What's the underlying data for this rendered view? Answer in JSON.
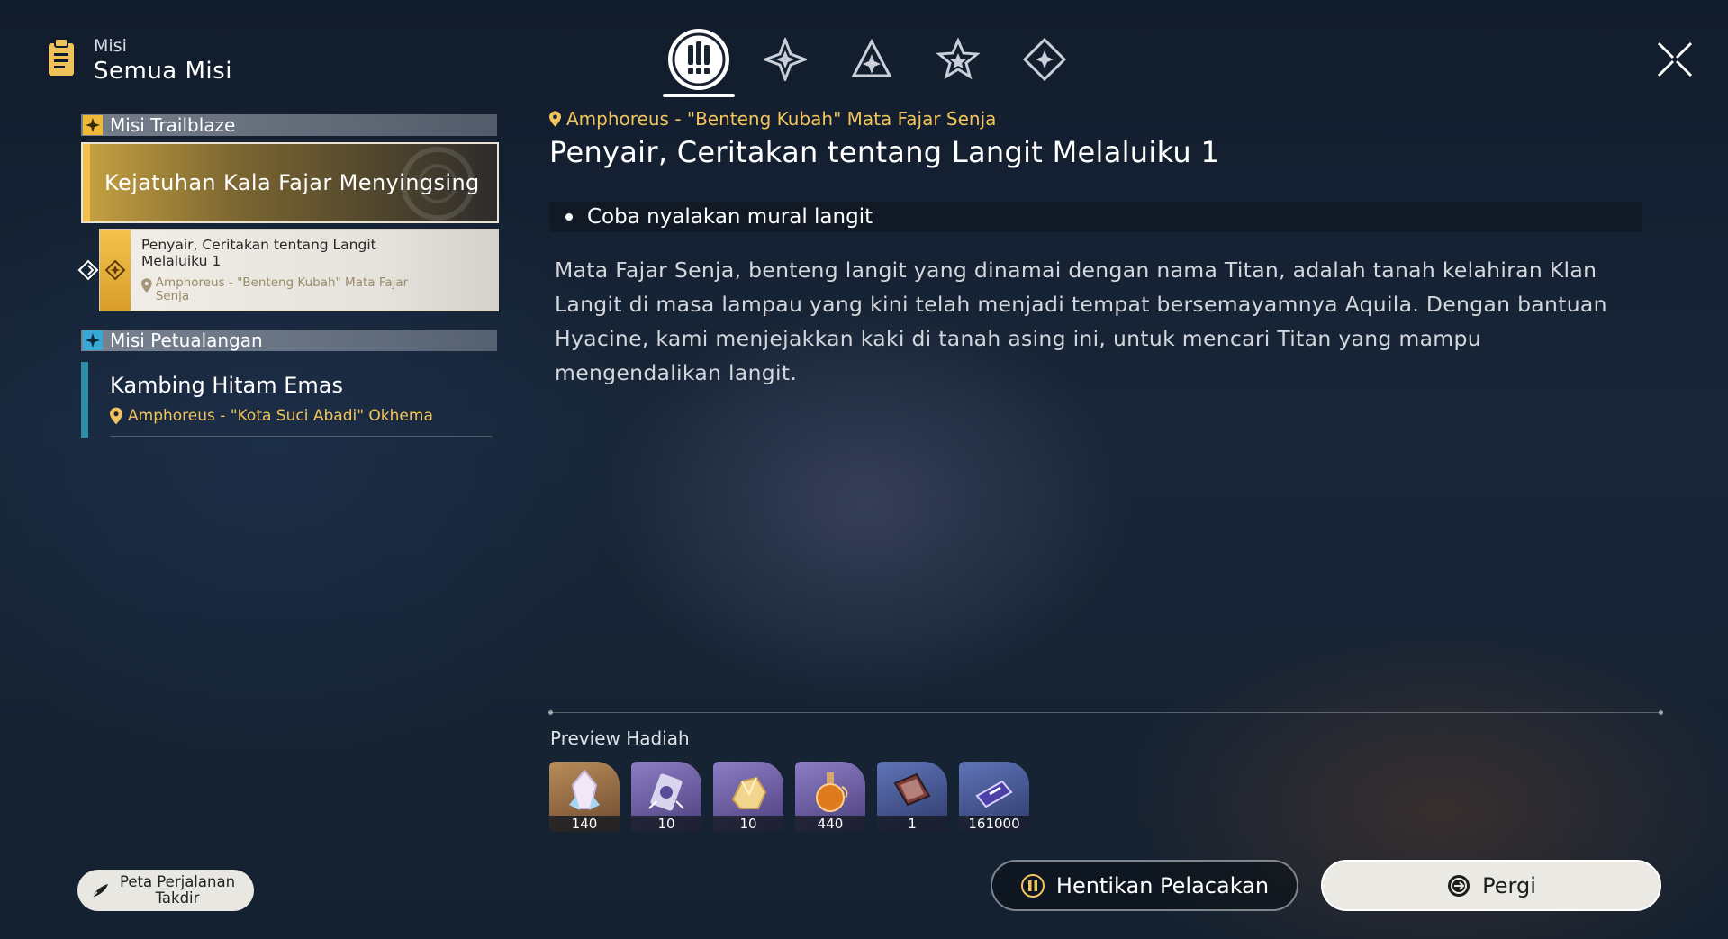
{
  "header": {
    "small_label": "Misi",
    "title": "Semua Misi"
  },
  "tabs": [
    {
      "icon": "trailblaze-exclamation-icon",
      "active": true
    },
    {
      "icon": "compass-star-icon",
      "active": false
    },
    {
      "icon": "triangle-star-icon",
      "active": false
    },
    {
      "icon": "star-icon",
      "active": false
    },
    {
      "icon": "diamond-star-icon",
      "active": false
    }
  ],
  "sidebar": {
    "trailblaze_section": "Misi Trailblaze",
    "main_quest": "Kejatuhan Kala Fajar Menyingsing",
    "sub_quest": {
      "title": "Penyair, Ceritakan tentang Langit Melaluiku 1",
      "location": "Amphoreus - \"Benteng Kubah\" Mata Fajar Senja"
    },
    "adventure_section": "Misi Petualangan",
    "adventure_quest": {
      "title": "Kambing Hitam Emas",
      "location": "Amphoreus - \"Kota Suci Abadi\" Okhema"
    },
    "fate_button": "Peta Perjalanan Takdir"
  },
  "detail": {
    "location": "Amphoreus - \"Benteng Kubah\" Mata Fajar Senja",
    "title": "Penyair, Ceritakan tentang Langit Melaluiku 1",
    "objective": "Coba nyalakan mural langit",
    "description": "Mata Fajar Senja, benteng langit yang dinamai dengan nama Titan, adalah tanah kelahiran Klan Langit di masa lampau yang kini telah menjadi tempat bersemayamnya Aquila. Dengan bantuan Hyacine, kami menjejakkan kaki di tanah asing ini, untuk mencari Titan yang mampu mengendalikan langit."
  },
  "rewards": {
    "label": "Preview Hadiah",
    "items": [
      {
        "icon": "crystal-icon",
        "qty": "140",
        "style": "gold"
      },
      {
        "icon": "pass-ticket-icon",
        "qty": "10",
        "style": "purple"
      },
      {
        "icon": "gold-ore-icon",
        "qty": "10",
        "style": "purple"
      },
      {
        "icon": "potion-flask-icon",
        "qty": "440",
        "style": "gold"
      },
      {
        "icon": "book-icon",
        "qty": "1",
        "style": "blue"
      },
      {
        "icon": "credit-icon",
        "qty": "161000",
        "style": "blue"
      }
    ]
  },
  "actions": {
    "stop_label": "Hentikan Pelacakan",
    "go_label": "Pergi"
  },
  "colors": {
    "accent_gold": "#f1c45c",
    "adventure_teal": "#2b8fa8"
  }
}
